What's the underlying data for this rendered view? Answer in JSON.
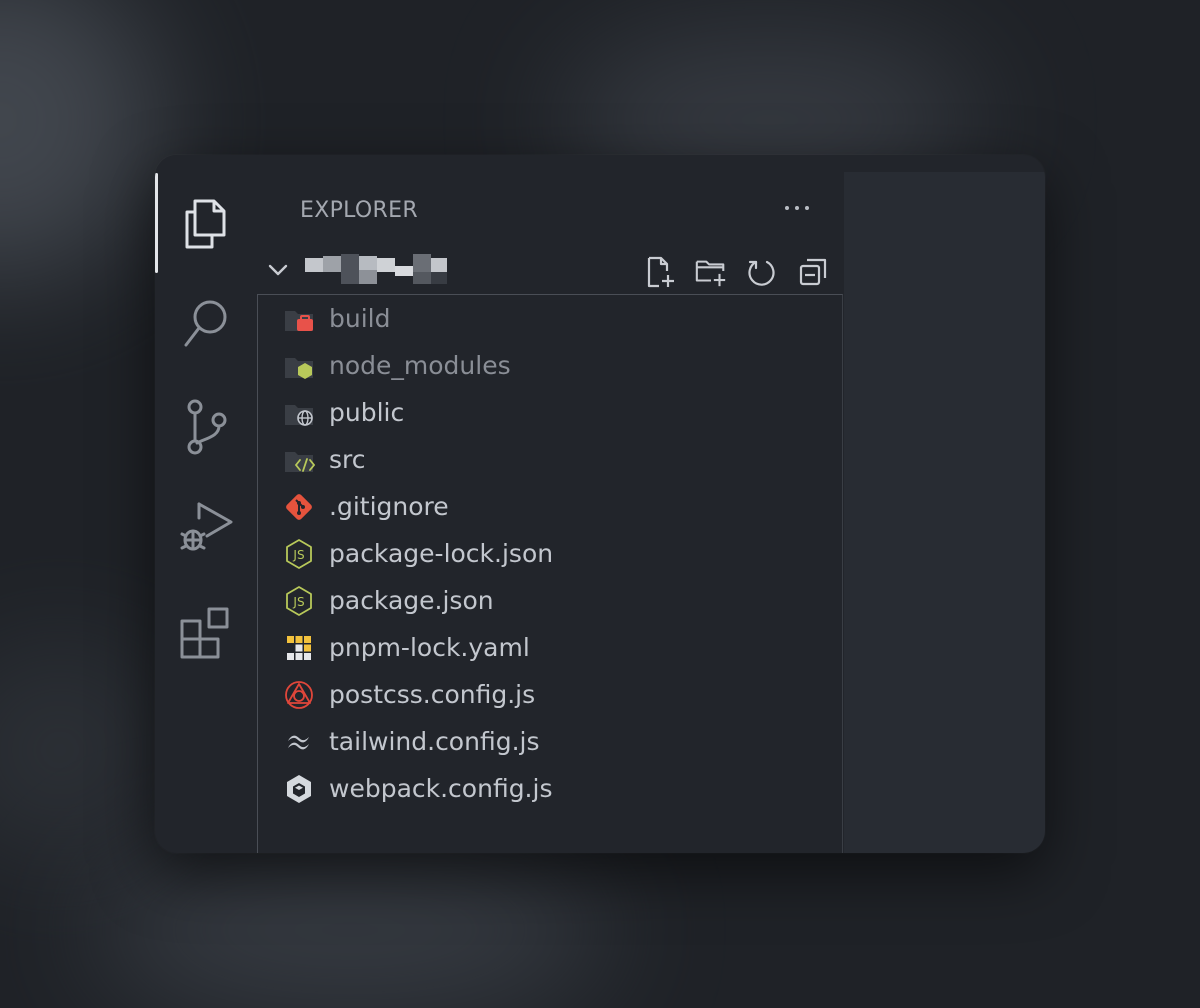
{
  "window": {
    "activity_bar": {
      "items": [
        {
          "id": "explorer",
          "icon": "files-icon",
          "active": true
        },
        {
          "id": "search",
          "icon": "search-icon",
          "active": false
        },
        {
          "id": "source-control",
          "icon": "source-control-icon",
          "active": false
        },
        {
          "id": "run-debug",
          "icon": "run-debug-icon",
          "active": false
        },
        {
          "id": "extensions",
          "icon": "extensions-icon",
          "active": false
        }
      ]
    },
    "sidebar": {
      "title": "EXPLORER",
      "more_icon": "ellipsis-icon",
      "root": {
        "expanded": true,
        "name_obscured": true,
        "tools": [
          {
            "id": "new-file",
            "icon": "new-file-icon"
          },
          {
            "id": "new-folder",
            "icon": "new-folder-icon"
          },
          {
            "id": "refresh",
            "icon": "refresh-icon"
          },
          {
            "id": "collapse-all",
            "icon": "collapse-all-icon"
          }
        ]
      },
      "items": [
        {
          "label": "build",
          "kind": "folder",
          "icon": "folder-build-icon",
          "dim": true
        },
        {
          "label": "node_modules",
          "kind": "folder",
          "icon": "folder-node-icon",
          "dim": true
        },
        {
          "label": "public",
          "kind": "folder",
          "icon": "folder-public-icon",
          "dim": false
        },
        {
          "label": "src",
          "kind": "folder",
          "icon": "folder-src-icon",
          "dim": false
        },
        {
          "label": ".gitignore",
          "kind": "file",
          "icon": "git-icon",
          "dim": false
        },
        {
          "label": "package-lock.json",
          "kind": "file",
          "icon": "nodejs-icon",
          "dim": false
        },
        {
          "label": "package.json",
          "kind": "file",
          "icon": "nodejs-icon",
          "dim": false
        },
        {
          "label": "pnpm-lock.yaml",
          "kind": "file",
          "icon": "pnpm-icon",
          "dim": false
        },
        {
          "label": "postcss.config.js",
          "kind": "file",
          "icon": "postcss-icon",
          "dim": false
        },
        {
          "label": "tailwind.config.js",
          "kind": "file",
          "icon": "tailwind-icon",
          "dim": false
        },
        {
          "label": "webpack.config.js",
          "kind": "file",
          "icon": "webpack-icon",
          "dim": false
        }
      ]
    }
  },
  "colors": {
    "background": "#1f2227",
    "panel": "#22252b",
    "editor": "#282c33",
    "text": "#c3c7ce",
    "text_dim": "#8a8e96",
    "icon": "#b9bdc4",
    "git": "#e5533d",
    "node": "#b8c95a",
    "build": "#e8524a",
    "postcss": "#e0463a",
    "webpack": "#d5d9de",
    "pnpm": "#f3c23d"
  }
}
